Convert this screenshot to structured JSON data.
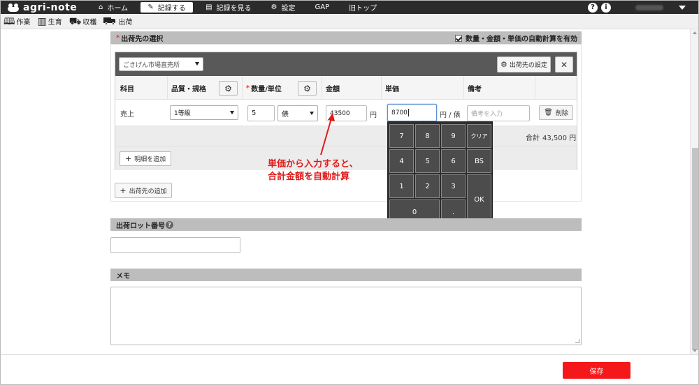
{
  "app": {
    "logo": "agri-note"
  },
  "nav": {
    "items": [
      {
        "label": "ホーム",
        "icon": "home-icon"
      },
      {
        "label": "記録する",
        "icon": "pencil-icon",
        "active": true
      },
      {
        "label": "記録を見る",
        "icon": "document-icon"
      },
      {
        "label": "設定",
        "icon": "gear-icon"
      },
      {
        "label": "GAP"
      },
      {
        "label": "旧トップ"
      }
    ],
    "help": "?",
    "info": "i"
  },
  "subnav": {
    "items": [
      {
        "label": "作業",
        "icon": "book-icon"
      },
      {
        "label": "生育",
        "icon": "growth-icon"
      },
      {
        "label": "収穫",
        "icon": "basket-icon"
      },
      {
        "label": "出荷",
        "icon": "truck-icon"
      }
    ]
  },
  "shipping": {
    "section_label": "出荷先の選択",
    "auto_calc_label": "数量・金額・単価の自動計算を有効",
    "auto_calc_checked": true,
    "destination": "ごきげん市場直売所",
    "destination_settings_label": "出荷先の設定",
    "close_label": "✕",
    "columns": [
      "科目",
      "品質・規格",
      "数量/単位",
      "金額",
      "単価",
      "備考"
    ],
    "row": {
      "subject": "売上",
      "quality": "1等級",
      "quantity": "5",
      "unit": "俵",
      "amount": "43500",
      "amount_unit": "円",
      "unit_price": "8700",
      "unit_price_unit": "円 / 俵",
      "note_placeholder": "備考を入力",
      "delete_label": "削除"
    },
    "total_label": "合計",
    "total_value": "43,500 円",
    "add_detail_label": "明細を追加",
    "add_destination_label": "出荷先の追加"
  },
  "keypad": {
    "keys": [
      "7",
      "8",
      "9",
      "クリア",
      "4",
      "5",
      "6",
      "BS",
      "1",
      "2",
      "3",
      "OK",
      "0",
      "."
    ]
  },
  "annotation": {
    "line1": "単価から入力すると、",
    "line2": "合計金額を自動計算"
  },
  "lot": {
    "label": "出荷ロット番号",
    "help": "?"
  },
  "memo": {
    "label": "メモ"
  },
  "footer": {
    "save_label": "保存"
  },
  "colors": {
    "accent": "#f5181b",
    "annotation": "#e01a1a",
    "nav_bg": "#2b2b2b"
  }
}
